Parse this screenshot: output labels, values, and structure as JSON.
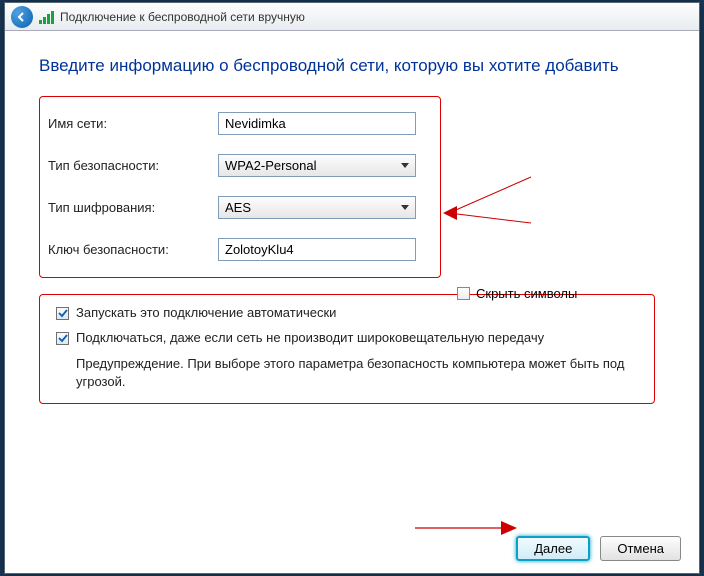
{
  "titlebar": {
    "title": "Подключение к беспроводной сети вручную"
  },
  "heading": "Введите информацию о беспроводной сети, которую вы хотите добавить",
  "form": {
    "name_label": "Имя сети:",
    "name_value": "Nevidimka",
    "sec_label": "Тип безопасности:",
    "sec_value": "WPA2-Personal",
    "enc_label": "Тип шифрования:",
    "enc_value": "AES",
    "key_label": "Ключ безопасности:",
    "key_value": "ZolotoyKlu4",
    "hide_label": "Скрыть символы"
  },
  "opts": {
    "auto": "Запускать это подключение автоматически",
    "broadcast": "Подключаться, даже если сеть не производит широковещательную передачу",
    "warn": "Предупреждение. При выборе этого параметра безопасность компьютера может быть под угрозой."
  },
  "footer": {
    "next": "Далее",
    "cancel": "Отмена"
  }
}
